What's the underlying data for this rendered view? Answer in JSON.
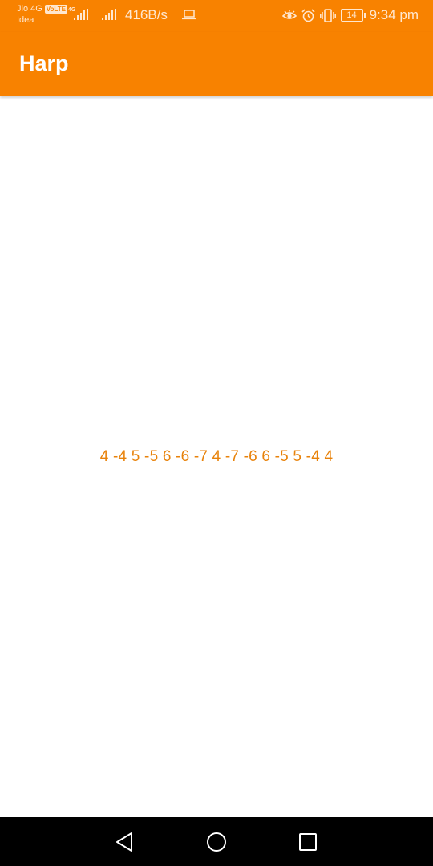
{
  "status_bar": {
    "carrier_primary": "Jio 4G",
    "volte": "VoLTE",
    "carrier_secondary": "Idea",
    "network_type": "4G",
    "data_speed": "416B/s",
    "battery_level": "14",
    "time": "9:34 pm",
    "icons": [
      "signal-icon",
      "laptop-icon",
      "eye-icon",
      "alarm-icon",
      "vibrate-icon",
      "battery-icon"
    ]
  },
  "app_bar": {
    "title": "Harp"
  },
  "content": {
    "notes": "4 -4 5 -5 6 -6 -7 4 -7 -6 6 -5 5 -4 4"
  },
  "nav_bar": {
    "icons": [
      "back-icon",
      "home-icon",
      "recents-icon"
    ]
  },
  "colors": {
    "primary": "#f88200",
    "notes_text": "#e8820a",
    "nav_background": "#000000"
  }
}
